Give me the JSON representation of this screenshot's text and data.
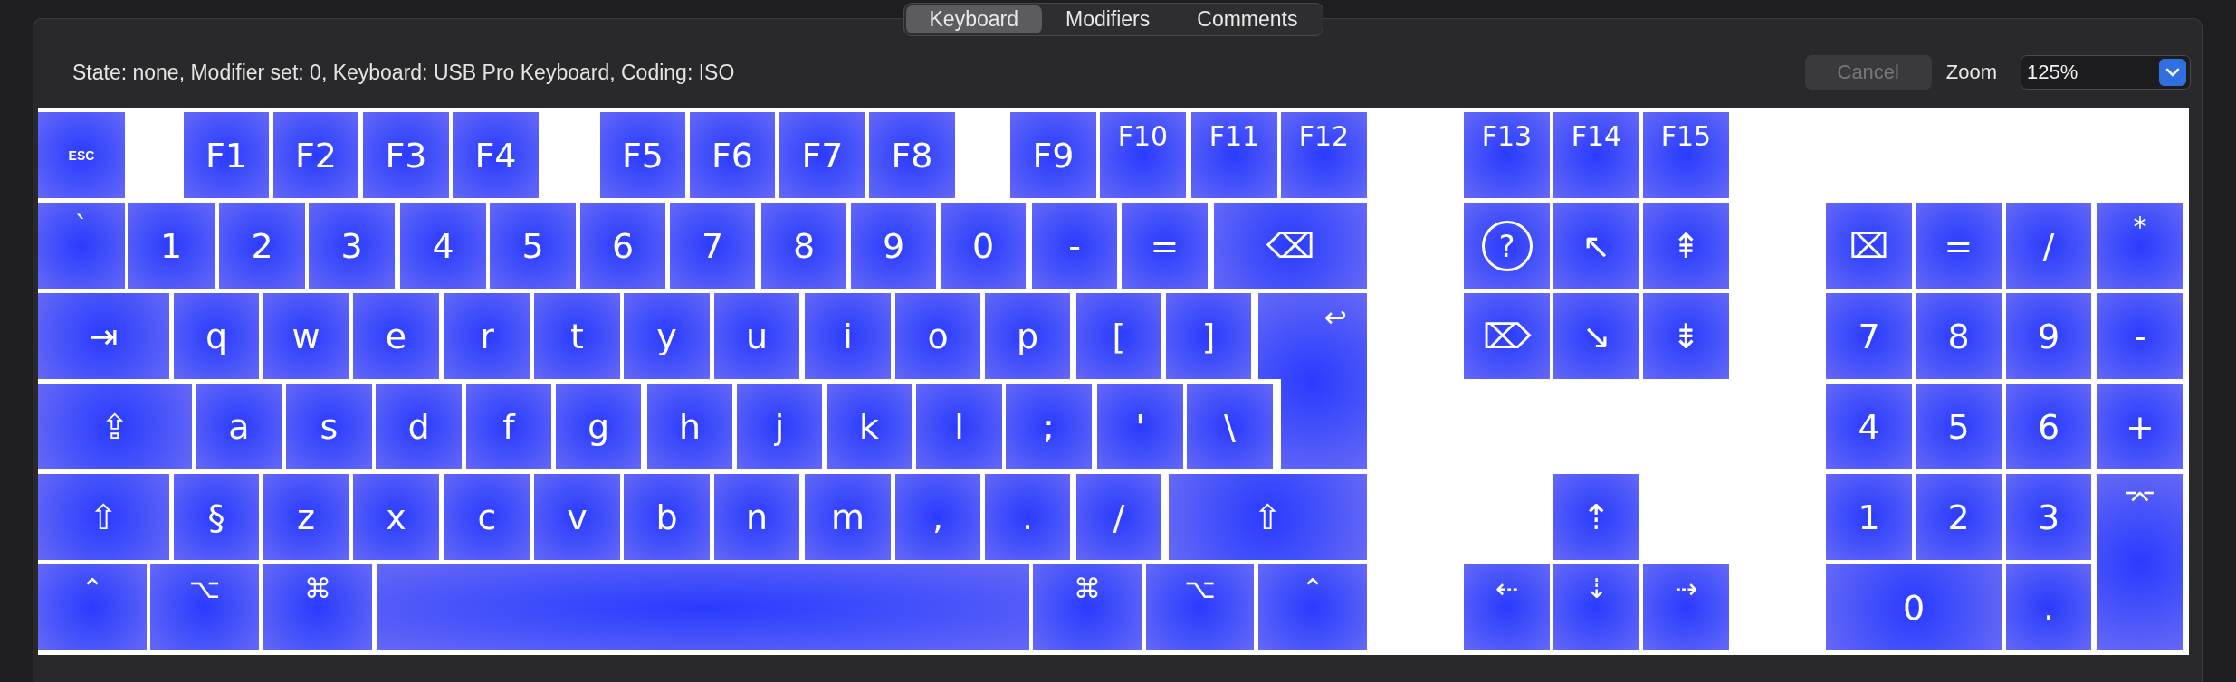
{
  "tabs": [
    {
      "label": "Keyboard",
      "selected": true
    },
    {
      "label": "Modifiers",
      "selected": false
    },
    {
      "label": "Comments",
      "selected": false
    }
  ],
  "toolbar": {
    "status": "State: none, Modifier set: 0, Keyboard: USB Pro Keyboard, Coding: ISO",
    "cancel": {
      "label": "Cancel",
      "disabled": true
    },
    "zoom": {
      "label": "Zoom",
      "value": "125%"
    }
  },
  "keys": [
    {
      "label": "ESC",
      "kind": "small"
    },
    {
      "label": "F1",
      "kind": "key"
    },
    {
      "label": "F2",
      "kind": "key"
    },
    {
      "label": "F3",
      "kind": "key"
    },
    {
      "label": "F4",
      "kind": "key"
    },
    {
      "label": "F5",
      "kind": "key"
    },
    {
      "label": "F6",
      "kind": "key"
    },
    {
      "label": "F7",
      "kind": "key"
    },
    {
      "label": "F8",
      "kind": "key"
    },
    {
      "label": "F9",
      "kind": "key"
    },
    {
      "label": "F10",
      "kind": "top"
    },
    {
      "label": "F11",
      "kind": "top"
    },
    {
      "label": "F12",
      "kind": "top"
    },
    {
      "label": "F13",
      "kind": "top"
    },
    {
      "label": "F14",
      "kind": "top"
    },
    {
      "label": "F15",
      "kind": "top"
    },
    {
      "label": "`",
      "kind": "top"
    },
    {
      "label": "1",
      "kind": "key"
    },
    {
      "label": "2",
      "kind": "key"
    },
    {
      "label": "3",
      "kind": "key"
    },
    {
      "label": "4",
      "kind": "key"
    },
    {
      "label": "5",
      "kind": "key"
    },
    {
      "label": "6",
      "kind": "key"
    },
    {
      "label": "7",
      "kind": "key"
    },
    {
      "label": "8",
      "kind": "key"
    },
    {
      "label": "9",
      "kind": "key"
    },
    {
      "label": "0",
      "kind": "key"
    },
    {
      "label": "-",
      "kind": "key"
    },
    {
      "label": "=",
      "kind": "key"
    },
    {
      "label": "⌫",
      "kind": "key"
    },
    {
      "label": "?",
      "kind": "circled"
    },
    {
      "label": "↖",
      "kind": "key"
    },
    {
      "label": "⇞",
      "kind": "key"
    },
    {
      "label": "⌧",
      "kind": "key"
    },
    {
      "label": "=",
      "kind": "key"
    },
    {
      "label": "/",
      "kind": "key"
    },
    {
      "label": "*",
      "kind": "top"
    },
    {
      "label": "⇥",
      "kind": "key"
    },
    {
      "label": "q",
      "kind": "key"
    },
    {
      "label": "w",
      "kind": "key"
    },
    {
      "label": "e",
      "kind": "key"
    },
    {
      "label": "r",
      "kind": "key"
    },
    {
      "label": "t",
      "kind": "key"
    },
    {
      "label": "y",
      "kind": "key"
    },
    {
      "label": "u",
      "kind": "key"
    },
    {
      "label": "i",
      "kind": "key"
    },
    {
      "label": "o",
      "kind": "key"
    },
    {
      "label": "p",
      "kind": "key"
    },
    {
      "label": "[",
      "kind": "key"
    },
    {
      "label": "]",
      "kind": "key"
    },
    {
      "label": "↩",
      "kind": "top"
    },
    {
      "label": "⌦",
      "kind": "key"
    },
    {
      "label": "↘",
      "kind": "key"
    },
    {
      "label": "⇟",
      "kind": "key"
    },
    {
      "label": "7",
      "kind": "key"
    },
    {
      "label": "8",
      "kind": "key"
    },
    {
      "label": "9",
      "kind": "key"
    },
    {
      "label": "-",
      "kind": "key"
    },
    {
      "label": "⇪",
      "kind": "key"
    },
    {
      "label": "a",
      "kind": "key"
    },
    {
      "label": "s",
      "kind": "key"
    },
    {
      "label": "d",
      "kind": "key"
    },
    {
      "label": "f",
      "kind": "key"
    },
    {
      "label": "g",
      "kind": "key"
    },
    {
      "label": "h",
      "kind": "key"
    },
    {
      "label": "j",
      "kind": "key"
    },
    {
      "label": "k",
      "kind": "key"
    },
    {
      "label": "l",
      "kind": "key"
    },
    {
      "label": ";",
      "kind": "key"
    },
    {
      "label": "'",
      "kind": "key"
    },
    {
      "label": "\\",
      "kind": "key"
    },
    {
      "label": "4",
      "kind": "key"
    },
    {
      "label": "5",
      "kind": "key"
    },
    {
      "label": "6",
      "kind": "key"
    },
    {
      "label": "+",
      "kind": "key"
    },
    {
      "label": "⇧",
      "kind": "key"
    },
    {
      "label": "§",
      "kind": "key"
    },
    {
      "label": "z",
      "kind": "key"
    },
    {
      "label": "x",
      "kind": "key"
    },
    {
      "label": "c",
      "kind": "key"
    },
    {
      "label": "v",
      "kind": "key"
    },
    {
      "label": "b",
      "kind": "key"
    },
    {
      "label": "n",
      "kind": "key"
    },
    {
      "label": "m",
      "kind": "key"
    },
    {
      "label": ",",
      "kind": "key"
    },
    {
      "label": ".",
      "kind": "key"
    },
    {
      "label": "/",
      "kind": "key"
    },
    {
      "label": "⇧",
      "kind": "key"
    },
    {
      "label": "⇡",
      "kind": "key"
    },
    {
      "label": "1",
      "kind": "key"
    },
    {
      "label": "2",
      "kind": "key"
    },
    {
      "label": "3",
      "kind": "key"
    },
    {
      "label": "⌤",
      "kind": "top"
    },
    {
      "label": "⌃",
      "kind": "top"
    },
    {
      "label": "⌥",
      "kind": "top"
    },
    {
      "label": "⌘",
      "kind": "top"
    },
    {
      "kind": "blank"
    },
    {
      "label": "⌘",
      "kind": "top"
    },
    {
      "label": "⌥",
      "kind": "top"
    },
    {
      "label": "⌃",
      "kind": "top"
    },
    {
      "label": "⇠",
      "kind": "top"
    },
    {
      "label": "⇣",
      "kind": "top"
    },
    {
      "label": "⇢",
      "kind": "top"
    },
    {
      "label": "0",
      "kind": "key"
    },
    {
      "label": ".",
      "kind": "key"
    }
  ]
}
